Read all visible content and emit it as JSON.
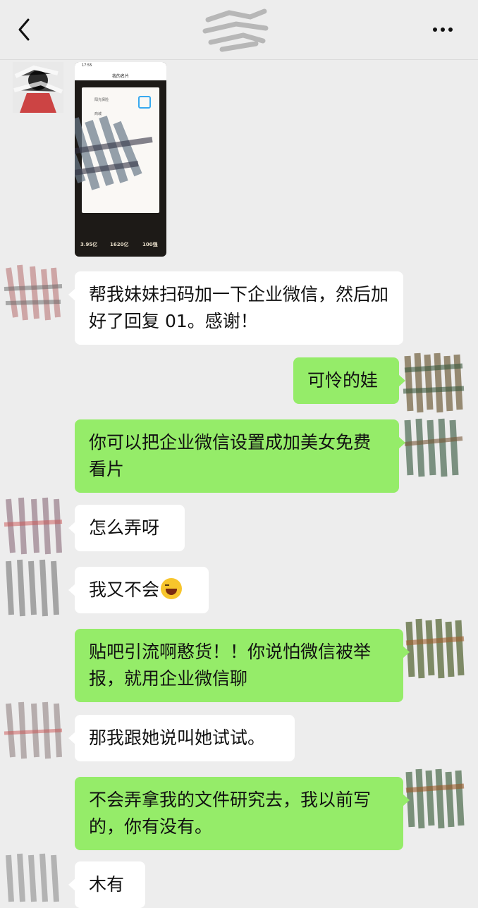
{
  "header": {
    "back_icon": "chevron-left-icon",
    "more_icon": "more-dots-icon"
  },
  "shared_card": {
    "status_time": "17:55",
    "nav_title": "我的名片",
    "line1": "阳光保险",
    "line2": "商城",
    "stats": [
      "3.95亿",
      "1620亿",
      "100强"
    ]
  },
  "messages": [
    {
      "side": "left",
      "text": "帮我妹妹扫码加一下企业微信，然后加好了回复 01。感谢！"
    },
    {
      "side": "right",
      "text": "可怜的娃"
    },
    {
      "side": "right",
      "text": "你可以把企业微信设置成加美女免费看片"
    },
    {
      "side": "left",
      "text": "怎么弄呀"
    },
    {
      "side": "left",
      "text": "我又不会",
      "emoji": "laughing-crying-emoji"
    },
    {
      "side": "right",
      "text": "贴吧引流啊憨货！！你说怕微信被举报，就用企业微信聊"
    },
    {
      "side": "left",
      "text": "那我跟她说叫她试试。"
    },
    {
      "side": "right",
      "text": "不会弄拿我的文件研究去，我以前写的，你有没有。"
    },
    {
      "side": "left",
      "text": "木有"
    }
  ],
  "colors": {
    "background": "#ededed",
    "left_bubble": "#ffffff",
    "right_bubble": "#95ec69"
  }
}
